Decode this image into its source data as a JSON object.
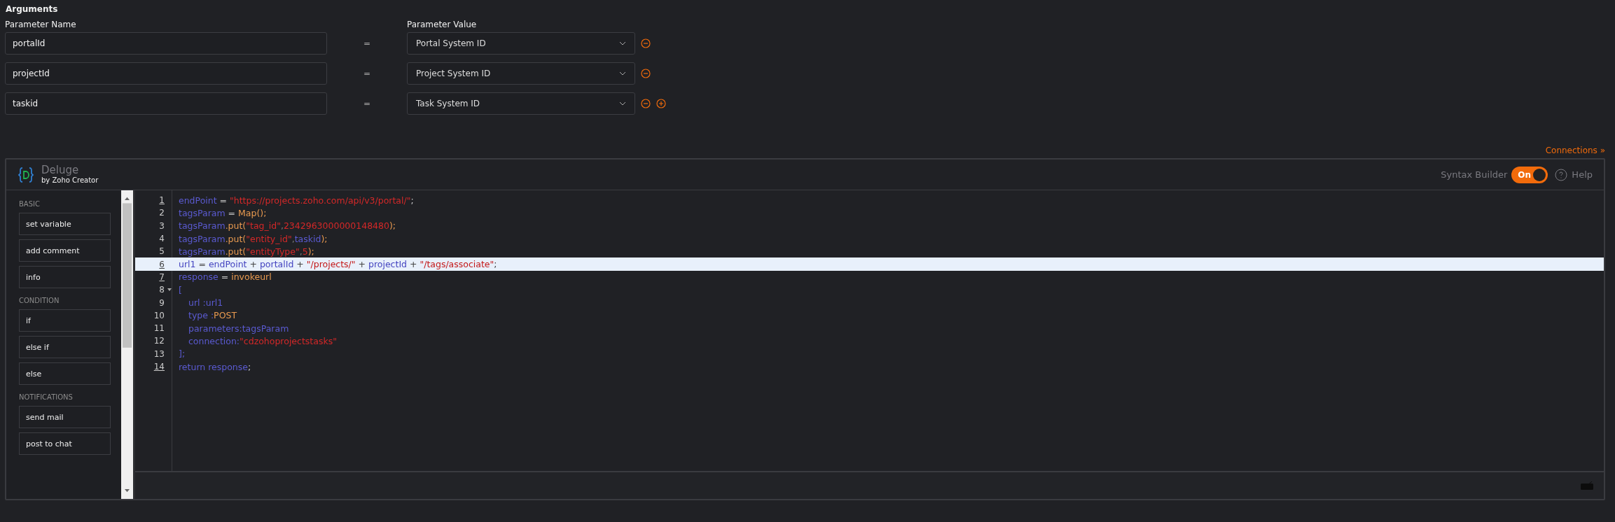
{
  "arguments": {
    "title": "Arguments",
    "name_header": "Parameter Name",
    "value_header": "Parameter Value",
    "rows": [
      {
        "name": "portalId",
        "equals": "=",
        "value": "Portal System ID",
        "can_add": false
      },
      {
        "name": "projectId",
        "equals": "=",
        "value": "Project System ID",
        "can_add": false
      },
      {
        "name": "taskid",
        "equals": "=",
        "value": "Task System ID",
        "can_add": true
      }
    ]
  },
  "connections_link": "Connections »",
  "editor": {
    "title": "Deluge",
    "subtitle": "by Zoho Creator",
    "syntax_builder": {
      "label": "Syntax Builder",
      "toggle_text": "On",
      "on": true
    },
    "help": "Help",
    "sidebar": [
      {
        "heading": "BASIC",
        "items": [
          "set variable",
          "add comment",
          "info"
        ]
      },
      {
        "heading": "CONDITION",
        "items": [
          "if",
          "else if",
          "else"
        ]
      },
      {
        "heading": "NOTIFICATIONS",
        "items": [
          "send mail",
          "post to chat"
        ]
      }
    ],
    "lines": [
      {
        "number": "1",
        "marked": true,
        "selected": false,
        "tokens": [
          {
            "kind": "var",
            "t": "endPoint"
          },
          {
            "kind": "op",
            "t": " = "
          },
          {
            "kind": "str",
            "t": "\"https://projects.zoho.com/api/v3/portal/\""
          },
          {
            "kind": "op",
            "t": ";"
          }
        ]
      },
      {
        "number": "2",
        "marked": false,
        "selected": false,
        "tokens": [
          {
            "kind": "var",
            "t": "tagsParam"
          },
          {
            "kind": "op",
            "t": " = "
          },
          {
            "kind": "fn",
            "t": "Map();"
          }
        ]
      },
      {
        "number": "3",
        "marked": false,
        "selected": false,
        "tokens": [
          {
            "kind": "var",
            "t": "tagsParam"
          },
          {
            "kind": "fn",
            "t": ".put("
          },
          {
            "kind": "str",
            "t": "\"tag_id\""
          },
          {
            "kind": "faint",
            "t": ","
          },
          {
            "kind": "str",
            "t": "2342963000000148480"
          },
          {
            "kind": "fn",
            "t": ");"
          }
        ]
      },
      {
        "number": "4",
        "marked": false,
        "selected": false,
        "tokens": [
          {
            "kind": "var",
            "t": "tagsParam"
          },
          {
            "kind": "fn",
            "t": ".put("
          },
          {
            "kind": "str",
            "t": "\"entity_id\""
          },
          {
            "kind": "faint",
            "t": ","
          },
          {
            "kind": "var",
            "t": "taskid"
          },
          {
            "kind": "fn",
            "t": ");"
          }
        ]
      },
      {
        "number": "5",
        "marked": false,
        "selected": false,
        "tokens": [
          {
            "kind": "var",
            "t": "tagsParam"
          },
          {
            "kind": "fn",
            "t": ".put("
          },
          {
            "kind": "str",
            "t": "\"entityType\""
          },
          {
            "kind": "faint",
            "t": ","
          },
          {
            "kind": "str",
            "t": "5"
          },
          {
            "kind": "fn",
            "t": ");"
          }
        ]
      },
      {
        "number": "6",
        "marked": true,
        "selected": true,
        "tokens": [
          {
            "kind": "var",
            "t": "url1"
          },
          {
            "kind": "op",
            "t": " = "
          },
          {
            "kind": "var",
            "t": "endPoint"
          },
          {
            "kind": "op",
            "t": " + "
          },
          {
            "kind": "var",
            "t": "portalId"
          },
          {
            "kind": "op",
            "t": " + "
          },
          {
            "kind": "str",
            "t": "\"/projects/\""
          },
          {
            "kind": "op",
            "t": " + "
          },
          {
            "kind": "var",
            "t": "projectId"
          },
          {
            "kind": "op",
            "t": " + "
          },
          {
            "kind": "str",
            "t": "\"/tags/associate\""
          },
          {
            "kind": "op",
            "t": ";"
          }
        ]
      },
      {
        "number": "7",
        "marked": true,
        "selected": false,
        "tokens": [
          {
            "kind": "var",
            "t": "response"
          },
          {
            "kind": "op",
            "t": " = "
          },
          {
            "kind": "fn",
            "t": "invokeurl"
          }
        ]
      },
      {
        "number": "8",
        "marked": false,
        "selected": false,
        "tokens": [
          {
            "kind": "var",
            "t": "["
          }
        ],
        "children": [
          {
            "number": "9",
            "marked": false,
            "selected": false,
            "tokens": [
              {
                "kind": "var",
                "t": "url :url1"
              }
            ]
          },
          {
            "number": "10",
            "marked": false,
            "selected": false,
            "tokens": [
              {
                "kind": "var",
                "t": "type :"
              },
              {
                "kind": "fn",
                "t": "POST"
              }
            ]
          },
          {
            "number": "11",
            "marked": false,
            "selected": false,
            "tokens": [
              {
                "kind": "var",
                "t": "parameters:tagsParam"
              }
            ]
          },
          {
            "number": "12",
            "marked": false,
            "selected": false,
            "tokens": [
              {
                "kind": "var",
                "t": "connection:"
              },
              {
                "kind": "str",
                "t": "\"cdzohoprojectstasks\""
              }
            ]
          }
        ]
      },
      {
        "number": "13",
        "marked": false,
        "selected": false,
        "tokens": [
          {
            "kind": "var",
            "t": "];"
          }
        ]
      },
      {
        "number": "14",
        "marked": true,
        "selected": false,
        "tokens": [
          {
            "kind": "var",
            "t": "return response"
          },
          {
            "kind": "op",
            "t": ";"
          }
        ]
      }
    ]
  }
}
